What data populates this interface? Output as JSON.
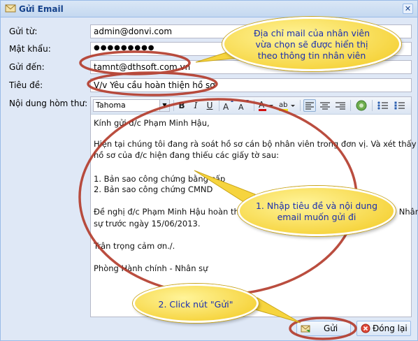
{
  "window": {
    "title": "Gửi Email",
    "close_glyph": "✕"
  },
  "form": {
    "from_label": "Gửi từ:",
    "from_value": "admin@donvi.com",
    "password_label": "Mật khẩu:",
    "password_value": "●●●●●●●●●",
    "to_label": "Gửi đến:",
    "to_value": "tamnt@dthsoft.com.vn",
    "subject_label": "Tiêu đề:",
    "subject_value": "V/v Yêu cầu hoàn thiện hồ sơ",
    "body_label": "Nội dung hòm thư:"
  },
  "editor": {
    "font": "Tahoma",
    "toolbar": {
      "bold": "B",
      "italic": "I",
      "underline": "U"
    },
    "lines": [
      "Kính gửi đ/c Phạm Minh Hậu,",
      "",
      "Hiện tại chúng tôi đang rà soát hồ sơ cán bộ nhân viên trong đơn vị. Và xét thấy",
      "hồ sơ của đ/c hiện đang thiếu các giấy tờ sau:",
      "",
      "1. Bản sao công chứng bằng cấp",
      "2. Bản sao công chứng CMND",
      "",
      "Đề nghị đ/c Phạm Minh Hậu hoàn thiện hồ sơ và gửi về phòng Hành chính - Nhân",
      "sự trước ngày 15/06/2013.",
      "",
      "Trân trọng cảm ơn./.",
      "",
      "Phòng Hành chính - Nhân sự"
    ]
  },
  "buttons": {
    "send": "Gửi",
    "close": "Đóng lại"
  },
  "callouts": {
    "address": [
      "Địa chỉ mail của nhân viên",
      "vừa chọn sẽ được hiển thị",
      "theo thông tin nhân viên"
    ],
    "step1": [
      "1. Nhập tiêu đề và nội dung",
      "email muốn gửi đi"
    ],
    "step2": [
      "2. Click nút \"Gửi\""
    ]
  },
  "colors": {
    "title": "#15428b",
    "highlight": "#b33a2a",
    "callout_fill": "#f6d43e",
    "callout_text": "#1a2fb0"
  }
}
